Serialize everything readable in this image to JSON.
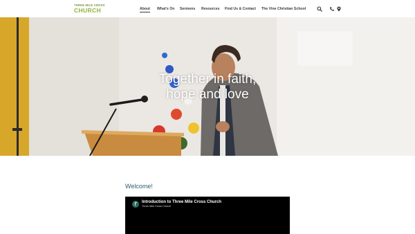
{
  "header": {
    "logo": {
      "line1": "THREE MILE CROSS",
      "line2": "CHURCH"
    },
    "nav": [
      {
        "label": "About",
        "active": true
      },
      {
        "label": "What's On"
      },
      {
        "label": "Sermons"
      },
      {
        "label": "Resources"
      },
      {
        "label": "Find Us & Contact"
      },
      {
        "label": "The Vine Christian School"
      }
    ],
    "icons": [
      "search-icon",
      "phone-icon",
      "map-pin-icon"
    ]
  },
  "hero": {
    "headline_line1": "Together in faith,",
    "headline_line2": "hope and love"
  },
  "main": {
    "welcome_heading": "Welcome!",
    "video": {
      "title": "Introduction to Three Mile Cross Church",
      "channel": "Three Mile Cross Church"
    }
  },
  "colors": {
    "logo_green": "#8fb23a",
    "heading_teal": "#2f5b6e",
    "nav_text": "#3a3a3a"
  }
}
